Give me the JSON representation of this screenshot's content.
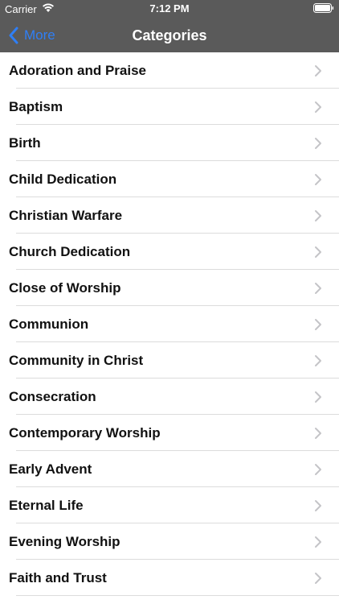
{
  "status_bar": {
    "carrier": "Carrier",
    "time": "7:12 PM",
    "wifi_icon": "wifi-icon",
    "battery_icon": "battery-icon"
  },
  "nav": {
    "back_label": "More",
    "title": "Categories",
    "back_icon": "chevron-left-icon",
    "accent_color": "#2f7ff6",
    "bar_color": "#5a5a5a"
  },
  "categories": [
    "Adoration and Praise",
    "Baptism",
    "Birth",
    "Child Dedication",
    "Christian Warfare",
    "Church Dedication",
    "Close of Worship",
    "Communion",
    "Community in Christ",
    "Consecration",
    "Contemporary Worship",
    "Early Advent",
    "Eternal Life",
    "Evening Worship",
    "Faith and Trust"
  ]
}
